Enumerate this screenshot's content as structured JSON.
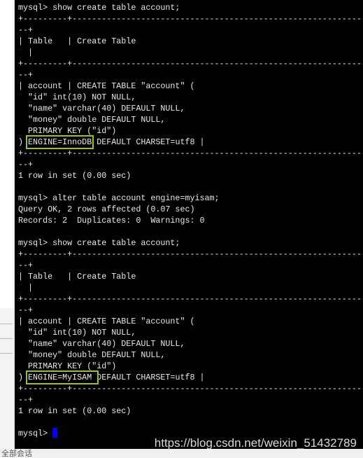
{
  "terminal": {
    "lines": [
      "mysql> show create table account;",
      "+---------+------------------------------------------------------------------------------------",
      "--+",
      "| Table   | Create Table",
      "  |",
      "+---------+------------------------------------------------------------------------------------",
      "--+",
      "| account | CREATE TABLE \"account\" (",
      "  \"id\" int(10) NOT NULL,",
      "  \"name\" varchar(40) DEFAULT NULL,",
      "  \"money\" double DEFAULT NULL,",
      "  PRIMARY KEY (\"id\")",
      {
        "pre": ") ",
        "hl": "ENGINE=InnoDB",
        "post": " DEFAULT CHARSET=utf8 |"
      },
      "+---------+------------------------------------------------------------------------------------",
      "--+",
      "1 row in set (0.00 sec)",
      "",
      "mysql> alter table account engine=myisam;",
      "Query OK, 2 rows affected (0.07 sec)",
      "Records: 2  Duplicates: 0  Warnings: 0",
      "",
      "mysql> show create table account;",
      "+---------+------------------------------------------------------------------------------------",
      "--+",
      "| Table   | Create Table",
      "  |",
      "+---------+------------------------------------------------------------------------------------",
      "--+",
      "| account | CREATE TABLE \"account\" (",
      "  \"id\" int(10) NOT NULL,",
      "  \"name\" varchar(40) DEFAULT NULL,",
      "  \"money\" double DEFAULT NULL,",
      "  PRIMARY KEY (\"id\")",
      {
        "pre": ") ",
        "hl": "ENGINE=MyISAM ",
        "post": "DEFAULT CHARSET=utf8 |"
      },
      "+---------+------------------------------------------------------------------------------------",
      "--+",
      "1 row in set (0.00 sec)",
      "",
      {
        "prompt": "mysql> "
      }
    ],
    "highlight_color": "#9bc31a",
    "cursor_color": "#0000ff"
  },
  "watermark": "https://blog.csdn.net/weixin_51432789",
  "bottom_bar": "全部会话"
}
